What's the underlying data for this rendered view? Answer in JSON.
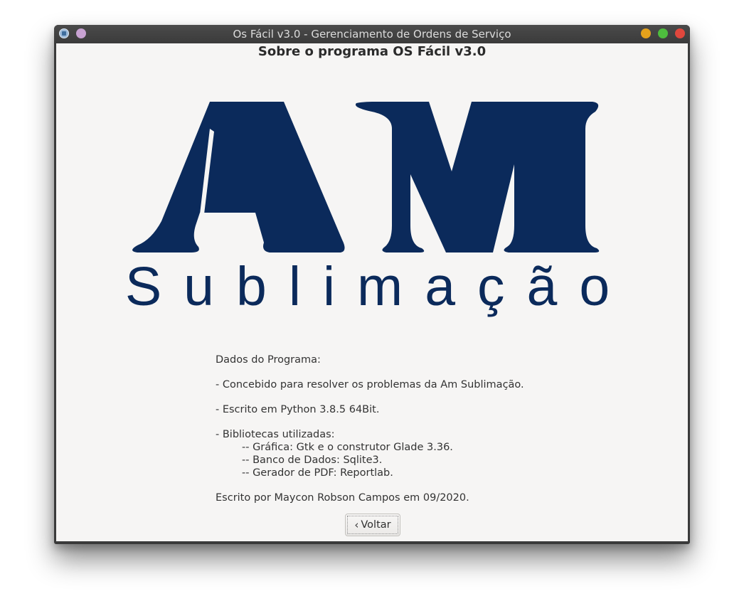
{
  "window": {
    "title": "Os Fácil v3.0 - Gerenciamento de Ordens de Serviço"
  },
  "dialog": {
    "heading": "Sobre o programa OS Fácil v3.0"
  },
  "logo": {
    "letters": "AM",
    "subtitle": "Sublimação",
    "color": "#0b2a5b"
  },
  "info": {
    "title": "Dados do Programa:",
    "line_purpose": "- Concebido para resolver os problemas da Am Sublimação.",
    "line_language": "- Escrito em Python 3.8.5 64Bit.",
    "libs_title": "- Bibliotecas utilizadas:",
    "libs": [
      "-- Gráfica: Gtk e o construtor Glade 3.36.",
      "-- Banco de Dados: Sqlite3.",
      "-- Gerador de PDF: Reportlab."
    ],
    "author": "Escrito por Maycon Robson Campos em 09/2020."
  },
  "buttons": {
    "back_label": "Voltar",
    "back_icon": "chevron-left-icon"
  },
  "titlebar_buttons": {
    "minimize_color": "#e5a21c",
    "maximize_color": "#4ebd3e",
    "close_color": "#e0473d"
  }
}
